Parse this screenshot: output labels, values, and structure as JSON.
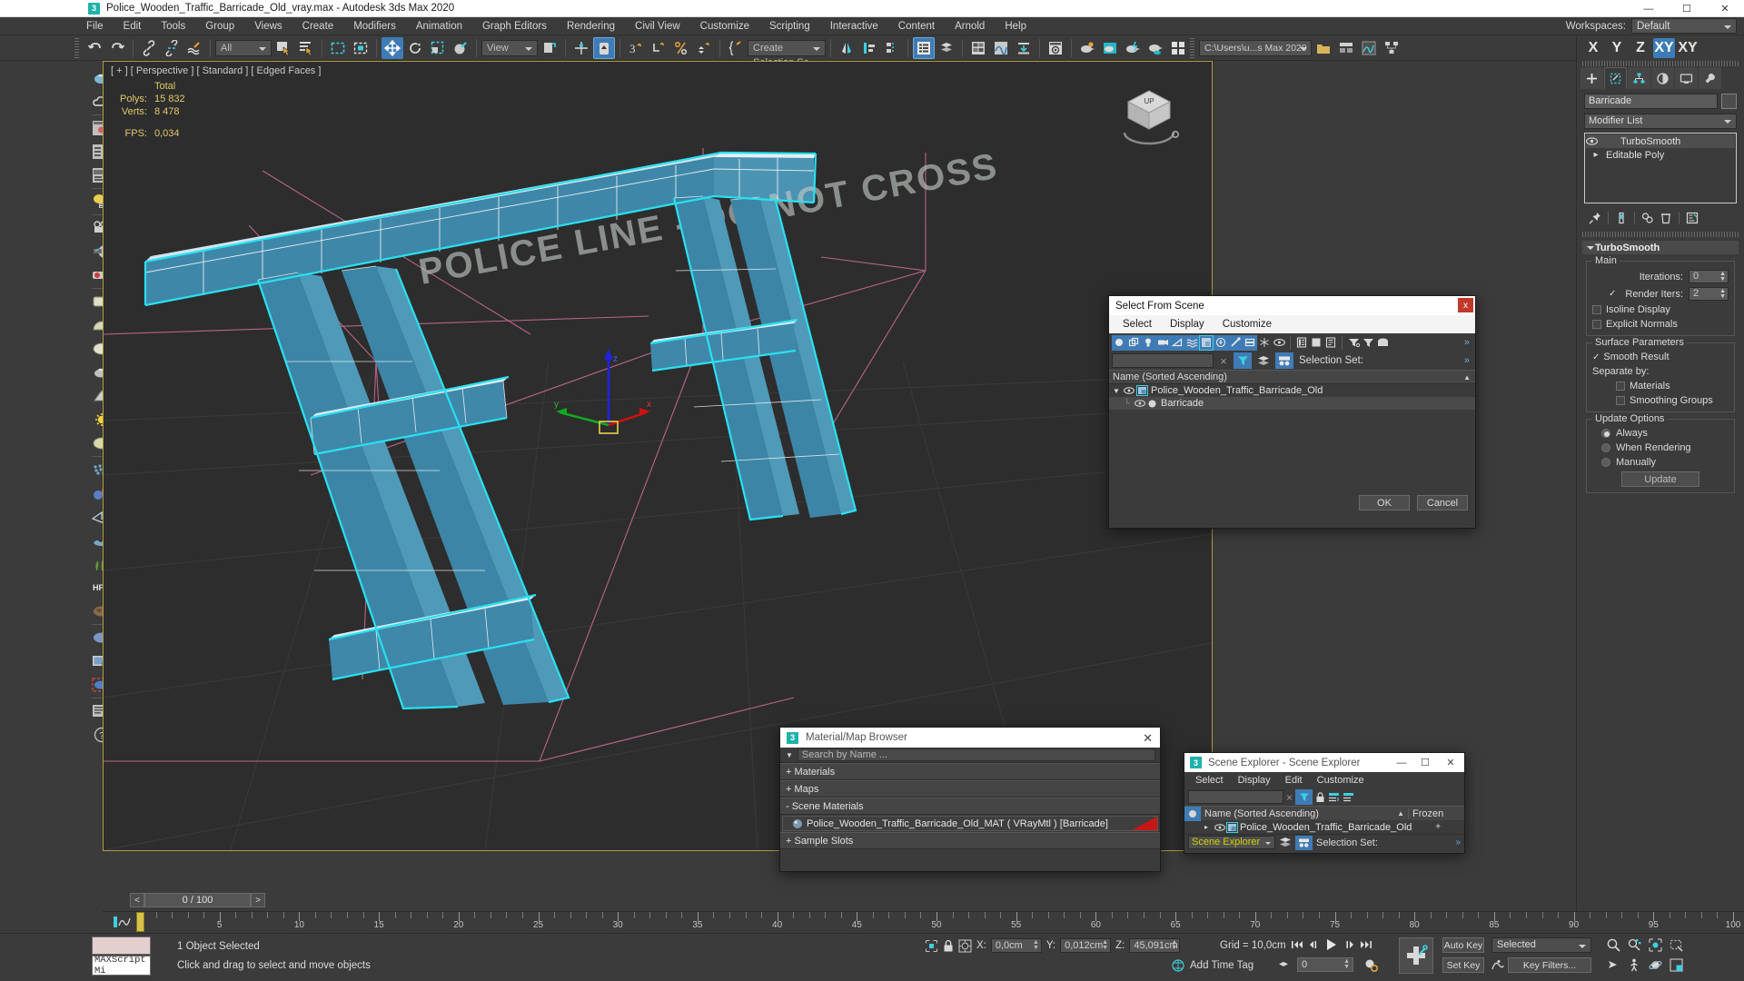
{
  "window": {
    "app_icon": "3",
    "title": "Police_Wooden_Traffic_Barricade_Old_vray.max - Autodesk 3ds Max 2020",
    "minimize": "—",
    "maximize": "☐",
    "close": "✕"
  },
  "menubar": {
    "items": [
      "File",
      "Edit",
      "Tools",
      "Group",
      "Views",
      "Create",
      "Modifiers",
      "Animation",
      "Graph Editors",
      "Rendering",
      "Civil View",
      "Customize",
      "Scripting",
      "Interactive",
      "Content",
      "Arnold",
      "Help"
    ]
  },
  "workspaces": {
    "label": "Workspaces:",
    "value": "Default"
  },
  "toolbar": {
    "filter_combo": "All",
    "ref_coord_combo": "View",
    "selection_set_combo": "Create Selection Se",
    "project_path": "C:\\Users\\u...s Max 2020"
  },
  "viewport": {
    "label": "[ + ] [ Perspective ] [ Standard ] [ Edged Faces ]",
    "stats": {
      "header": "Total",
      "polys_label": "Polys:",
      "polys_value": "15 832",
      "verts_label": "Verts:",
      "verts_value": "8 478",
      "fps_label": "FPS:",
      "fps_value": "0,034"
    },
    "axis_x": "x",
    "axis_y": "y",
    "axis_z": "z",
    "model_text": "POLICE LINE - DO NOT CROSS",
    "viewcube_top": "UP"
  },
  "command_panel": {
    "axis_buttons": [
      "X",
      "Y",
      "Z",
      "XY",
      "XY"
    ],
    "object_name": "Barricade",
    "modifier_list": "Modifier List",
    "stack": [
      {
        "name": "TurboSmooth",
        "selected": true
      },
      {
        "name": "Editable Poly",
        "selected": false
      }
    ],
    "turbosmooth": {
      "rollout_title": "TurboSmooth",
      "main_group": "Main",
      "iterations_label": "Iterations:",
      "iterations_value": "0",
      "render_iters_label": "Render Iters:",
      "render_iters_value": "2",
      "render_iters_checked": true,
      "isoline_display": "Isoline Display",
      "explicit_normals": "Explicit Normals",
      "surface_group": "Surface Parameters",
      "smooth_result": "Smooth Result",
      "smooth_result_checked": true,
      "separate_by": "Separate by:",
      "materials": "Materials",
      "smoothing_groups": "Smoothing Groups",
      "update_group": "Update Options",
      "option_always": "Always",
      "option_when_rendering": "When Rendering",
      "option_manually": "Manually",
      "selected_update_option": "Always",
      "update_button": "Update"
    }
  },
  "select_from_scene": {
    "title": "Select From Scene",
    "close": "x",
    "menu": [
      "Select",
      "Display",
      "Customize"
    ],
    "search_value": "",
    "selection_set_label": "Selection Set:",
    "column_header": "Name (Sorted Ascending)",
    "sort_arrow": "▲",
    "rows": [
      {
        "name": "Police_Wooden_Traffic_Barricade_Old",
        "indent": 0,
        "expanded": true
      },
      {
        "name": "Barricade",
        "indent": 1,
        "expanded": false
      }
    ],
    "ok": "OK",
    "cancel": "Cancel"
  },
  "material_browser": {
    "icon": "3",
    "title": "Material/Map Browser",
    "close": "✕",
    "search_placeholder": "Search by Name ...",
    "sections": [
      {
        "label": "+ Materials",
        "expanded": false
      },
      {
        "label": "+ Maps",
        "expanded": false
      },
      {
        "label": "- Scene Materials",
        "expanded": true
      },
      {
        "label": "+ Sample Slots",
        "expanded": false
      }
    ],
    "scene_material": "Police_Wooden_Traffic_Barricade_Old_MAT  ( VRayMtl )  [Barricade]"
  },
  "scene_explorer": {
    "icon": "3",
    "title": "Scene Explorer - Scene Explorer",
    "minimize": "—",
    "maximize": "☐",
    "close": "✕",
    "menu": [
      "Select",
      "Display",
      "Edit",
      "Customize"
    ],
    "search_value": "",
    "columns": [
      "Name (Sorted Ascending)",
      "Frozen"
    ],
    "sort_arrow": "▲",
    "rows": [
      {
        "name": "Police_Wooden_Traffic_Barricade_Old"
      }
    ],
    "footer_combo": "Scene Explorer",
    "selection_set_label": "Selection Set:"
  },
  "timeline": {
    "prev_arrow": "<",
    "next_arrow": ">",
    "current_frame_display": "0 / 100",
    "ticks": [
      "5",
      "10",
      "15",
      "20",
      "25",
      "30",
      "35",
      "40",
      "45",
      "50",
      "55",
      "60",
      "65",
      "70",
      "75",
      "80",
      "85",
      "90",
      "95",
      "100"
    ]
  },
  "statusbar": {
    "maxscript_mini_label": "MAXScript Mi",
    "selection_status": "1 Object Selected",
    "prompt": "Click and drag to select and move objects",
    "coords": {
      "x_label": "X:",
      "x_value": "0,0cm",
      "y_label": "Y:",
      "y_value": "0,012cm",
      "z_label": "Z:",
      "z_value": "45,091cm"
    },
    "grid_label": "Grid = 10,0cm",
    "add_time_tag": "Add Time Tag",
    "frame_value": "0",
    "auto_key": "Auto Key",
    "set_key": "Set Key",
    "key_mode_combo": "Selected",
    "key_filters": "Key Filters..."
  },
  "colors": {
    "accent_blue": "#3f7cb6",
    "selection_cyan": "#2ae0f0",
    "object_blue": "#3d88ab",
    "viewport_bg": "#2d2d2d",
    "panel_bg": "#3b3b3b",
    "stat_yellow": "#e0c86a",
    "teal_icon": "#20b2aa",
    "red_flag": "#c81616",
    "grid_pink": "#d4688f"
  }
}
